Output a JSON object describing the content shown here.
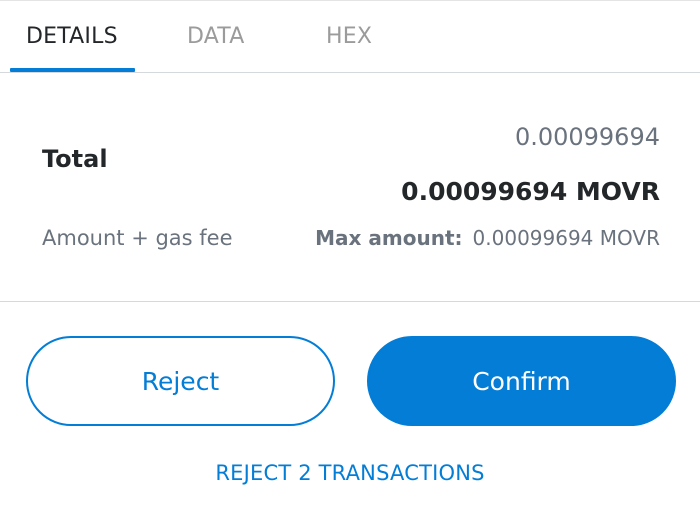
{
  "tabs": [
    {
      "label": "DETAILS",
      "active": true
    },
    {
      "label": "DATA",
      "active": false
    },
    {
      "label": "HEX",
      "active": false
    }
  ],
  "total": {
    "label": "Total",
    "secondary_amount": "0.00099694",
    "primary_amount": "0.00099694 MOVR",
    "subtitle": "Amount + gas fee",
    "max_label": "Max amount:",
    "max_value": "0.00099694 MOVR"
  },
  "actions": {
    "reject_label": "Reject",
    "confirm_label": "Confirm",
    "reject_all_label": "REJECT 2 TRANSACTIONS"
  },
  "colors": {
    "accent": "#037dd6",
    "text_primary": "#24272a",
    "text_secondary": "#6a737d"
  }
}
